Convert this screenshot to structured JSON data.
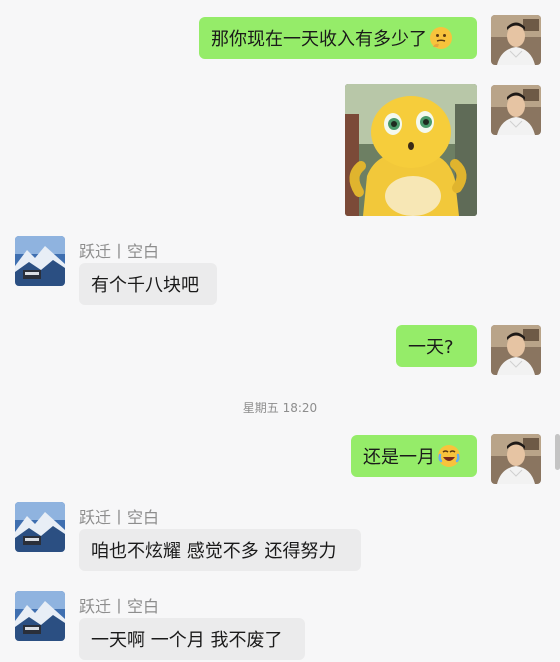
{
  "chat": {
    "contact": "跃迁丨空白",
    "messages": [
      {
        "text": "那你现在一天收入有多少了",
        "emoji": "thinking-face"
      },
      {
        "sticker": "yellow-cartoon-character"
      },
      {
        "text": "有个千八块吧"
      },
      {
        "text": "一天?"
      },
      {
        "text": "还是一月",
        "emoji": "rolling-laughing-face"
      },
      {
        "text": "咱也不炫耀 感觉不多 还得努力"
      },
      {
        "text": "一天啊 一个月 我不废了"
      }
    ],
    "time_separator": "星期五 18:20"
  },
  "colors": {
    "outgoing_bubble": "#95ec69",
    "incoming_bubble": "#ebebec",
    "background": "#f7f7f8"
  }
}
